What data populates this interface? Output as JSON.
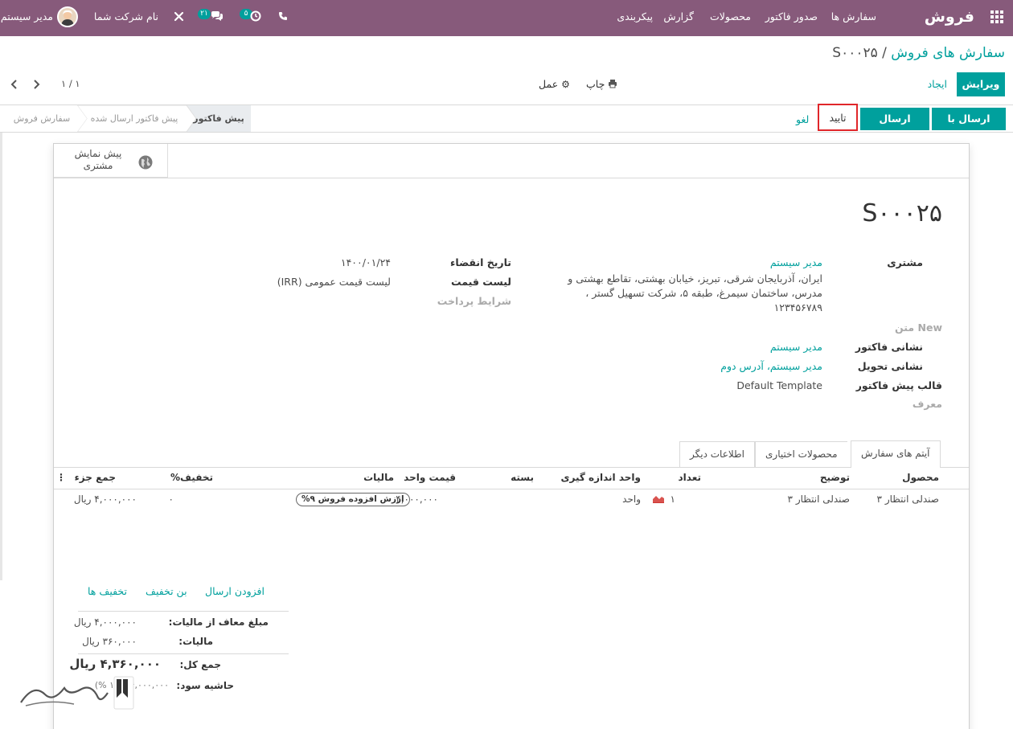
{
  "navbar": {
    "app_name": "فروش",
    "menu": [
      "سفارش ها",
      "صدور فاکتور",
      "محصولات",
      "گزارش",
      "پیکربندی"
    ],
    "company": "نام شرکت شما",
    "user": "مدیر سیستم",
    "messages_count": "۲۱",
    "activities_count": "۵"
  },
  "breadcrumb": {
    "parent": "سفارش های فروش",
    "separator": "/",
    "current": "S۰۰۰۲۵"
  },
  "toolbar": {
    "edit": "ویرایش",
    "create": "ایجاد",
    "print": "چاپ",
    "action": "عمل",
    "pager": "۱ / ۱"
  },
  "header_buttons": {
    "send_email": "ارسال با ایمیل",
    "send_proforma": "ارسال پروفرما",
    "confirm": "تایید",
    "cancel": "لغو"
  },
  "status_bar": {
    "steps": [
      "پیش فاکتور",
      "پیش فاکتور ارسال شده",
      "سفارش فروش"
    ],
    "active_index": 0
  },
  "smart_button": {
    "label_line1": "پیش نمایش",
    "label_line2": "مشتری"
  },
  "order": {
    "name": "S۰۰۰۲۵",
    "customer_label": "مشتری",
    "customer_name": "مدیر سیستم",
    "customer_address_1": "ایران، آذربایجان شرقی، تبریز، خیابان بهشتی، تقاطع بهشتی و",
    "customer_address_2": "مدرس، ساختمان سیمرغ، طبقه ۵، شرکت تسهیل گستر ،",
    "customer_address_3": "۱۲۳۴۵۶۷۸۹",
    "new_text_label": "New متن",
    "invoice_address_label": "نشانی فاکتور",
    "invoice_address": "مدیر سیستم",
    "delivery_address_label": "نشانی تحویل",
    "delivery_address": "مدیر سیستم، آدرس دوم",
    "template_label": "قالب پیش فاکتور",
    "template": "Default Template",
    "referrer_label": "معرف",
    "expiration_label": "تاریخ انقضاء",
    "expiration": "۱۴۰۰/۰۱/۲۴",
    "pricelist_label": "لیست قیمت",
    "pricelist": "لیست قیمت عمومی (IRR)",
    "payment_terms_label": "شرایط پرداخت"
  },
  "tabs": [
    "آیتم های سفارش",
    "محصولات اختیاری",
    "اطلاعات دیگر"
  ],
  "lines": {
    "headers": [
      "محصول",
      "توضیح",
      "تعداد",
      "واحد اندازه گیری",
      "بسته",
      "قیمت واحد",
      "مالیات",
      "تخفیف%",
      "جمع جزء"
    ],
    "rows": [
      {
        "product": "صندلی انتظار ۳",
        "description": "صندلی انتظار ۳",
        "quantity": "۱",
        "uom": "واحد",
        "package": "",
        "unit_price": "۴,۰۰۰,۰۰۰",
        "tax": "ارزش افزوده فروش ۹%",
        "discount": "۰",
        "subtotal": "۴,۰۰۰,۰۰۰ ریال"
      }
    ]
  },
  "line_actions": {
    "add_shipping": "افزودن ارسال",
    "coupon": "بن تخفیف",
    "promotions": "تخفیف ها"
  },
  "totals": {
    "untaxed_label": "مبلغ معاف از مالیات:",
    "untaxed": "۴,۰۰۰,۰۰۰ ریال",
    "taxes_label": "مالیات:",
    "taxes": "۳۶۰,۰۰۰ ریال",
    "total_label": "جمع کل:",
    "total": "۴,۳۶۰,۰۰۰ ریال",
    "margin_label": "حاشیه سود:",
    "margin": "۴,۰۰۰,۰۰۰ (۱۰۰ %)"
  },
  "colors": {
    "navbar": "#875a7b",
    "primary": "#00a09d",
    "highlight": "#e0262a"
  }
}
